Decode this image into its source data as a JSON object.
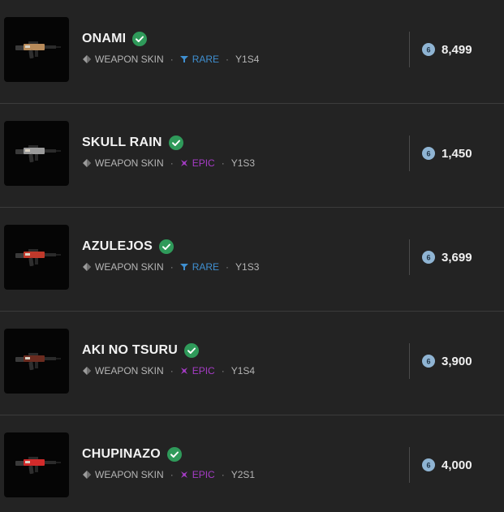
{
  "items": [
    {
      "name": "ONAMI",
      "type": "WEAPON SKIN",
      "rarity": "RARE",
      "rarity_key": "rare",
      "season": "Y1S4",
      "price": "8,499",
      "owned": true,
      "skin_color": "#b88b5a"
    },
    {
      "name": "SKULL RAIN",
      "type": "WEAPON SKIN",
      "rarity": "EPIC",
      "rarity_key": "epic",
      "season": "Y1S3",
      "price": "1,450",
      "owned": true,
      "skin_color": "#9a9a9a"
    },
    {
      "name": "AZULEJOS",
      "type": "WEAPON SKIN",
      "rarity": "RARE",
      "rarity_key": "rare",
      "season": "Y1S3",
      "price": "3,699",
      "owned": true,
      "skin_color": "#c0392b"
    },
    {
      "name": "AKI NO TSURU",
      "type": "WEAPON SKIN",
      "rarity": "EPIC",
      "rarity_key": "epic",
      "season": "Y1S4",
      "price": "3,900",
      "owned": true,
      "skin_color": "#6b2b1f"
    },
    {
      "name": "CHUPINAZO",
      "type": "WEAPON SKIN",
      "rarity": "EPIC",
      "rarity_key": "epic",
      "season": "Y2S1",
      "price": "4,000",
      "owned": true,
      "skin_color": "#d22b2b"
    }
  ],
  "colors": {
    "rare": "#3f8fd0",
    "epic": "#a63cc6",
    "owned_check": "#2f9a5a",
    "coin": "#8fb4d3"
  },
  "icons": {
    "type": "weapon-skin-icon",
    "owned": "check-circle-icon",
    "rare": "rare-funnel-icon",
    "epic": "epic-cross-icon",
    "currency": "r6-credits-icon"
  }
}
